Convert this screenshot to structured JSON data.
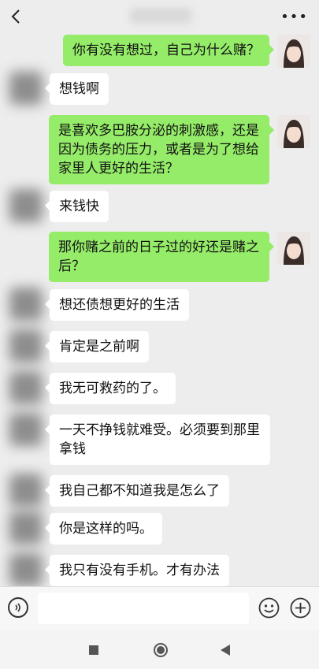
{
  "header": {
    "title_blurred": ""
  },
  "messages": [
    {
      "side": "right",
      "text": "你有没有想过，自己为什么赌？"
    },
    {
      "side": "left",
      "text": "想钱啊"
    },
    {
      "side": "right",
      "text": "是喜欢多巴胺分泌的刺激感，还是因为债务的压力，或者是为了想给家里人更好的生活？"
    },
    {
      "side": "left",
      "text": "来钱快"
    },
    {
      "side": "right",
      "text": "那你赌之前的日子过的好还是赌之后？"
    },
    {
      "side": "left",
      "text": "想还债想更好的生活"
    },
    {
      "side": "left",
      "text": "肯定是之前啊"
    },
    {
      "side": "left",
      "text": "我无可救药的了。"
    },
    {
      "side": "left",
      "text": "一天不挣钱就难受。必须要到那里拿钱"
    },
    {
      "side": "left",
      "text": "我自己都不知道我是怎么了"
    },
    {
      "side": "left",
      "text": "你是这样的吗。"
    },
    {
      "side": "left",
      "text": "我只有没有手机。才有办法"
    }
  ],
  "icons": {
    "back": "chevron-left-icon",
    "more": "more-dots-icon",
    "voice": "voice-icon",
    "emoji": "emoji-icon",
    "plus": "plus-icon"
  },
  "colors": {
    "background": "#ededed",
    "self_bubble": "#95ec69",
    "other_bubble": "#ffffff"
  }
}
